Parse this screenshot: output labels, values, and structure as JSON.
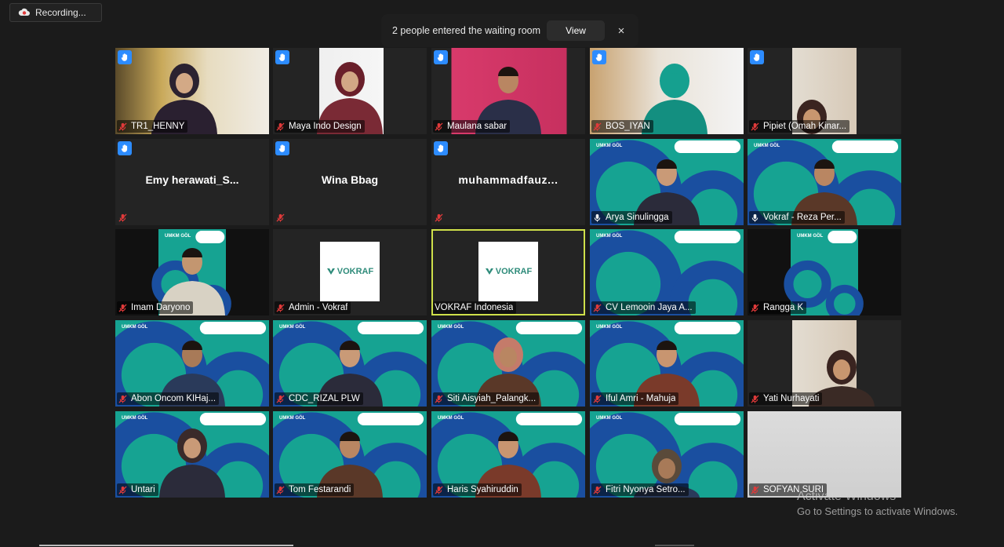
{
  "recording": {
    "label": "Recording..."
  },
  "waiting_room": {
    "message": "2 people entered the waiting room",
    "view_label": "View",
    "close_label": "×"
  },
  "participants": [
    {
      "name": "TR1_HENNY",
      "hand": true,
      "mic": "muted",
      "video": "office"
    },
    {
      "name": "Maya Indo Design",
      "hand": true,
      "mic": "muted",
      "video": "whitewall"
    },
    {
      "name": "Maulana sabar",
      "hand": true,
      "mic": "muted",
      "video": "pinkwall"
    },
    {
      "name": "BOS_IYAN",
      "hand": true,
      "mic": "muted",
      "video": "tealroom"
    },
    {
      "name": "Pipiet (Omah Kinar...",
      "hand": true,
      "mic": "muted",
      "video": "room"
    },
    {
      "name": "",
      "display": "Emy  herawati_S...",
      "hand": true,
      "mic": "muted",
      "video": "none"
    },
    {
      "name": "",
      "display": "Wina Bbag",
      "hand": true,
      "mic": "muted",
      "video": "none"
    },
    {
      "name": "",
      "display": "muhammadfauz...",
      "hand": true,
      "mic": "muted",
      "video": "none"
    },
    {
      "name": "Arya Sinulingga",
      "hand": false,
      "mic": "on",
      "video": "umkm"
    },
    {
      "name": "Vokraf - Reza Per...",
      "hand": false,
      "mic": "on",
      "video": "umkm"
    },
    {
      "name": "Imam Daryono",
      "hand": false,
      "mic": "muted",
      "video": "umkm-narrow"
    },
    {
      "name": "Admin - Vokraf",
      "hand": false,
      "mic": "muted",
      "video": "logo"
    },
    {
      "name": "VOKRAF Indonesia",
      "hand": false,
      "mic": "none",
      "video": "logo",
      "active": true
    },
    {
      "name": "CV Lemooin Jaya A...",
      "hand": false,
      "mic": "muted",
      "video": "umkm"
    },
    {
      "name": "Rangga K",
      "hand": false,
      "mic": "muted",
      "video": "umkm-narrow"
    },
    {
      "name": "Abon Oncom KIHaj...",
      "hand": false,
      "mic": "muted",
      "video": "umkm"
    },
    {
      "name": "CDC_RIZAL PLW",
      "hand": false,
      "mic": "muted",
      "video": "umkm"
    },
    {
      "name": "Siti Aisyiah_Palangk...",
      "hand": false,
      "mic": "muted",
      "video": "umkm"
    },
    {
      "name": "Iful Amri - Mahuja",
      "hand": false,
      "mic": "muted",
      "video": "umkm"
    },
    {
      "name": "Yati Nurhayati",
      "hand": false,
      "mic": "muted",
      "video": "room"
    },
    {
      "name": "Untari",
      "hand": false,
      "mic": "muted",
      "video": "umkm"
    },
    {
      "name": "Tom Festarandi",
      "hand": false,
      "mic": "muted",
      "video": "umkm"
    },
    {
      "name": "Haris Syahiruddin",
      "hand": false,
      "mic": "muted",
      "video": "umkm"
    },
    {
      "name": "Fitri Nyonya Setro...",
      "hand": false,
      "mic": "muted",
      "video": "umkm"
    },
    {
      "name": "SOFYAN SURI",
      "hand": false,
      "mic": "muted",
      "video": "gray"
    }
  ],
  "logo_text": "VOKRAF",
  "banner_text": "UMKM GÖL",
  "activation": {
    "title": "Activate Windows",
    "subtitle": "Go to Settings to activate Windows."
  },
  "colors": {
    "raised_hand": "#2d8cff",
    "muted_mic": "#e03a3a",
    "active_speaker": "#cfe04a",
    "brand_teal": "#16a392",
    "brand_blue": "#1a4fa0"
  }
}
